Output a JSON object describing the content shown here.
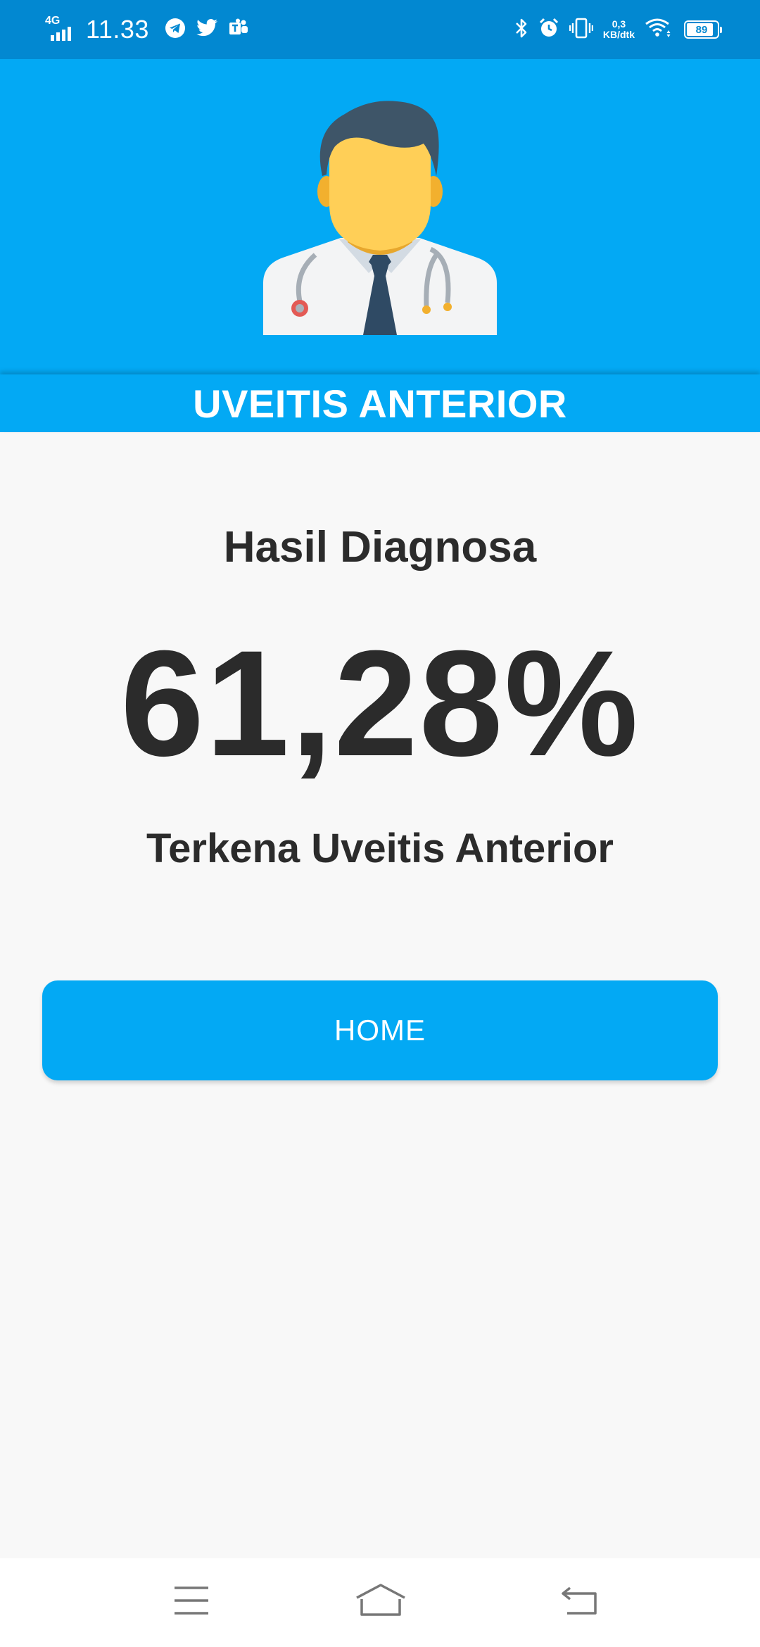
{
  "status_bar": {
    "network": "4G",
    "time": "11.33",
    "speed_value": "0,3",
    "speed_unit": "KB/dtk",
    "battery": "89",
    "battery_level": 0.89,
    "icons": [
      "telegram-icon",
      "twitter-icon",
      "teams-icon",
      "bluetooth-icon",
      "alarm-icon",
      "vibrate-icon",
      "wifi-icon"
    ]
  },
  "header": {
    "avatar_icon": "doctor-avatar-icon",
    "title": "UVEITIS ANTERIOR"
  },
  "content": {
    "subtitle": "Hasil Diagnosa",
    "percentage": "61,28%",
    "result": "Terkena Uveitis Anterior"
  },
  "actions": {
    "home_label": "HOME"
  },
  "nav_bar": {
    "icons": [
      "menu-icon",
      "home-icon",
      "back-icon"
    ]
  },
  "colors": {
    "status_bar": "#0288d1",
    "primary": "#03a9f4",
    "background": "#f8f8f8",
    "text": "#2b2b2b"
  }
}
